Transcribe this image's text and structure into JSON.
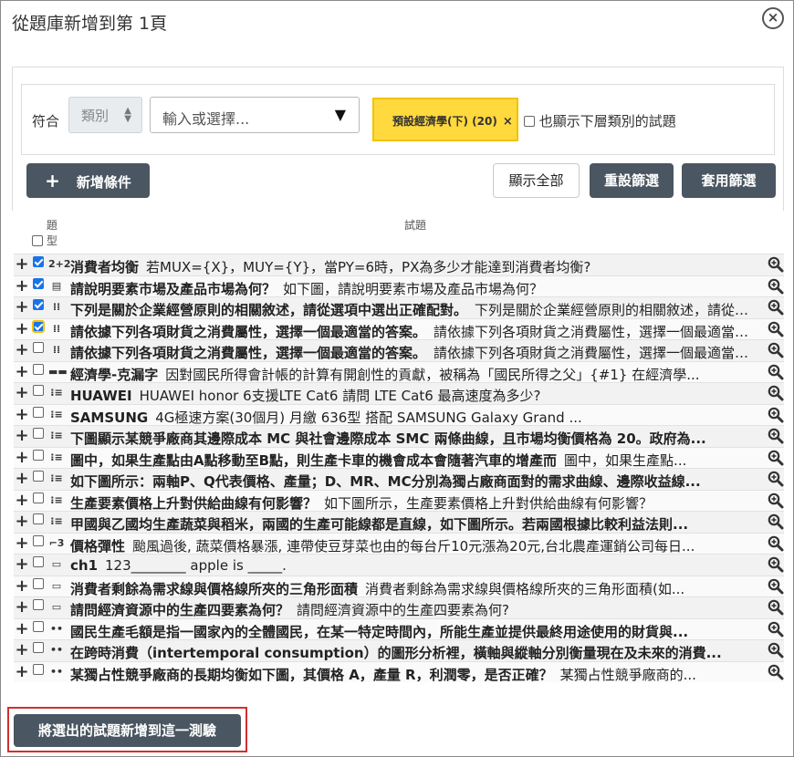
{
  "dialog": {
    "title": "從題庫新增到第 1頁",
    "close_icon": "close-icon"
  },
  "filter": {
    "match_label": "符合",
    "category_select": "類別",
    "search_placeholder": "輸入或選擇...",
    "tag_label": "預設經濟學(下) (20)",
    "tag_remove": "×",
    "include_sub_label": "也顯示下層類別的試題",
    "add_condition_label": "新增條件",
    "show_all_label": "顯示全部",
    "reset_label": "重設篩選",
    "apply_label": "套用篩選"
  },
  "table": {
    "col_type": "題型",
    "col_question": "試題"
  },
  "questions": [
    {
      "checked": true,
      "icon": "calculated-icon",
      "glyph": "2+2",
      "name": "消費者均衡",
      "text": "若MUX={X}，MUY={Y}，當PY=6時，PX為多少才能達到消費者均衡?"
    },
    {
      "checked": true,
      "icon": "essay-icon",
      "glyph": "▤",
      "name": "請說明要素市場及產品市場為何？",
      "text": "如下圖，請說明要素市場及產品市場為何？"
    },
    {
      "checked": true,
      "icon": "matching-icon",
      "glyph": "⁞⁞",
      "name": "下列是關於企業經營原則的相關敘述，請從選項中選出正確配對。",
      "text": "下列是關於企業經營原則的相關敘述，請從選項中選出正確配對。"
    },
    {
      "checked": true,
      "icon": "matching-icon",
      "glyph": "⁞⁞",
      "name": "請依據下列各項財貨之消費屬性，選擇一個最適當的答案。",
      "text": "請依據下列各項財貨之消費屬性，選擇一個最適當的答案。",
      "focus": true
    },
    {
      "checked": false,
      "icon": "matching-icon",
      "glyph": "⁞⁞",
      "name": "請依據下列各項財貨之消費屬性，選擇一個最適當的答案。",
      "text": "請依據下列各項財貨之消費屬性，選擇一個最適當的答案。"
    },
    {
      "checked": false,
      "icon": "cloze-icon",
      "glyph": "▬▬",
      "name": "經濟學-克漏字",
      "text": "因對國民所得會計帳的計算有開創性的貢獻，被稱為「國民所得之父」{#1} 在經濟學..."
    },
    {
      "checked": false,
      "icon": "multichoice-icon",
      "glyph": "⁝≡",
      "name": "HUAWEI",
      "text": "HUAWEI honor 6支援LTE Cat6 請問 LTE Cat6 最高速度為多少?"
    },
    {
      "checked": false,
      "icon": "multichoice-icon",
      "glyph": "⁝≡",
      "name": "SAMSUNG",
      "text": "4G極速方案(30個月) 月繳 636型 搭配 SAMSUNG Galaxy Grand ..."
    },
    {
      "checked": false,
      "icon": "multichoice-icon",
      "glyph": "⁝≡",
      "name": "下圖顯示某競爭廠商其邊際成本 MC 與社會邊際成本 SMC 兩條曲線，且市場均衡價格為 20。政府為...",
      "text": ""
    },
    {
      "checked": false,
      "icon": "multichoice-icon",
      "glyph": "⁝≡",
      "name": "圖中，如果生產點由A點移動至B點，則生產卡車的機會成本會隨著汽車的增產而",
      "text": "圖中，如果生產點..."
    },
    {
      "checked": false,
      "icon": "multichoice-icon",
      "glyph": "⁝≡",
      "name": "如下圖所示：兩軸P、Q代表價格、產量；D、MR、MC分別為獨占廠商面對的需求曲線、邊際收益線...",
      "text": ""
    },
    {
      "checked": false,
      "icon": "multichoice-icon",
      "glyph": "⁝≡",
      "name": "生產要素價格上升對供給曲線有何影響？",
      "text": "如下圖所示，生產要素價格上升對供給曲線有何影響？"
    },
    {
      "checked": false,
      "icon": "multichoice-icon",
      "glyph": "⁝≡",
      "name": "甲國與乙國均生產蔬菜與稻米，兩國的生產可能線都是直線，如下圖所示。若兩國根據比較利益法則...",
      "text": ""
    },
    {
      "checked": false,
      "icon": "numerical-icon",
      "glyph": "⌐3",
      "name": "價格彈性",
      "text": "颱風過後, 蔬菜價格暴漲, 連帶使豆芽菜也由的每台斤10元漲為20元,台北農產運銷公司每日..."
    },
    {
      "checked": false,
      "icon": "shortanswer-icon",
      "glyph": "▭",
      "name": "ch1",
      "text": "123________ apple is _____."
    },
    {
      "checked": false,
      "icon": "shortanswer-icon",
      "glyph": "▭",
      "name": "消費者剩餘為需求線與價格線所夾的三角形面積",
      "text": "消費者剩餘為需求線與價格線所夾的三角形面積(如..."
    },
    {
      "checked": false,
      "icon": "shortanswer-icon",
      "glyph": "▭",
      "name": "請問經濟資源中的生產四要素為何？",
      "text": "請問經濟資源中的生產四要素為何?"
    },
    {
      "checked": false,
      "icon": "truefalse-icon",
      "glyph": "••",
      "name": "國民生產毛額是指一國家內的全體國民，在某一特定時間內，所能生產並提供最終用途使用的財貨與...",
      "text": ""
    },
    {
      "checked": false,
      "icon": "truefalse-icon",
      "glyph": "••",
      "name": "在跨時消費（intertemporal consumption）的圖形分析裡，橫軸與縱軸分別衡量現在及未來的消費...",
      "text": ""
    },
    {
      "checked": false,
      "icon": "truefalse-icon",
      "glyph": "••",
      "name": "某獨占性競爭廠商的長期均衡如下圖，其價格 A，產量 R，利潤零，是否正確？",
      "text": "某獨占性競爭廠商的..."
    }
  ],
  "footer": {
    "submit_label": "將選出的試題新增到這一測驗"
  }
}
